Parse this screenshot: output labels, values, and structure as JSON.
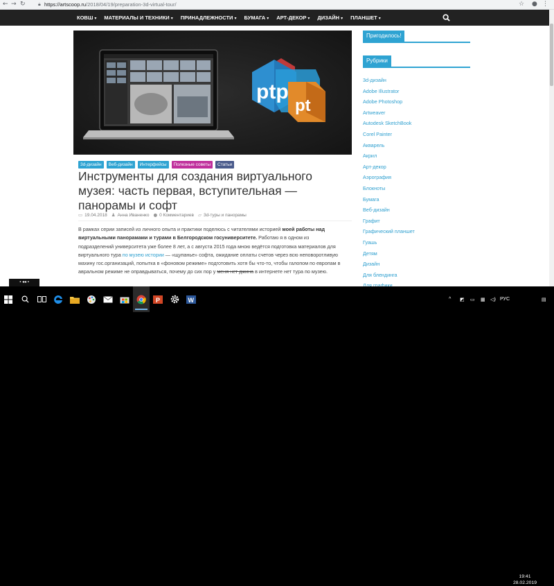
{
  "browser": {
    "url_host": "https://artscoop.ru",
    "url_path": "/2018/04/19/preparation-3d-virtual-tour/"
  },
  "nav": {
    "items": [
      {
        "label": "КОВШ"
      },
      {
        "label": "МАТЕРИАЛЫ И ТЕХНИКИ"
      },
      {
        "label": "ПРИНАДЛЕЖНОСТИ"
      },
      {
        "label": "БУМАГА"
      },
      {
        "label": "АРТ-ДЕКОР"
      },
      {
        "label": "ДИЗАЙН"
      },
      {
        "label": "ПЛАНШЕТ"
      }
    ]
  },
  "hero": {
    "logo_main": "ptp",
    "logo_secondary": "pt"
  },
  "article": {
    "tags": [
      {
        "label": "3d-дизайн",
        "color": "#2ea3d2"
      },
      {
        "label": "Веб-дизайн",
        "color": "#2ea3d2"
      },
      {
        "label": "Интерфейсы",
        "color": "#2ea3d2"
      },
      {
        "label": "Полезные советы",
        "color": "#c0309c"
      },
      {
        "label": "Статьи",
        "color": "#4a5b8c"
      }
    ],
    "title": "Инструменты для создания виртуального музея: часть первая, вступительная — панорамы и софт",
    "date": "19.04.2018",
    "author": "Анна Иваненко",
    "comments": "0 Комментариев",
    "category": "3d-туры и панорамы",
    "p1": "В рамках серии записей из личного опыта и практики поделюсь с читателями историей ",
    "p1_bold": "моей работы над виртуальными панорамами и турами в Белгородском госуниверситете.",
    "p1_rest": " Работаю я в одном из подразделений университета уже более 8 лет, а с августа 2015 года мною ведётся подготовка материалов для виртуального тура ",
    "p1_link": "по музею истории",
    "p1_rest2": " — «щупанье» софта, ожидание оплаты счетов через всю неповоротливую махину гос.организаций, попытка в «фоновом режиме» подготовить хотя бы что-то, чтобы галопом по европам в авральном режиме не оправдываться, почему до сих пор у ",
    "p1_strike": "меня нет джина",
    "p1_end": " в интернете нет тура по музею."
  },
  "sidebar": {
    "widget_title": "Пригодилось!",
    "rubrics_title": "Рубрики",
    "rubrics": [
      "3d-дизайн",
      "Adobe Illustrator",
      "Adobe Photoshop",
      "Artweaver",
      "Autodesk SketchBook",
      "Corel Painter",
      "Акварель",
      "Акрил",
      "Арт-декор",
      "Аэрография",
      "Блокноты",
      "Бумага",
      "Веб-дизайн",
      "Графит",
      "Графический планшет",
      "Гуашь",
      "Детям",
      "Дизайн",
      "Для блендинга",
      "Для графики"
    ]
  },
  "float_widget": {
    "label": "▪ ◂◂ ▪"
  },
  "taskbar": {
    "lang": "РУС",
    "time": "19:41",
    "date": "28.02.2019"
  }
}
